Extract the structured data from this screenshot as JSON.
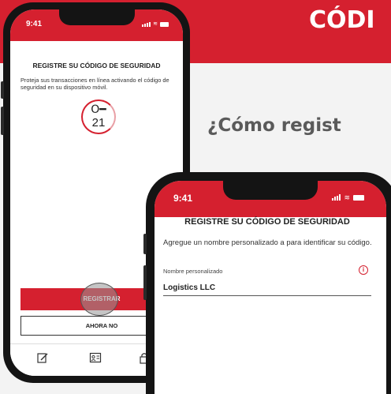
{
  "banner": {
    "title": "CÓDI",
    "color": "#d5202f"
  },
  "subtitle": "¿Cómo regist",
  "phone_back": {
    "status": {
      "time": "9:41"
    },
    "heading": "REGISTRE SU CÓDIGO DE SEGURIDAD",
    "description": "Proteja sus transacciones en línea activando el código de seguridad en su dispositivo móvil.",
    "key_icon": "key-icon",
    "key_number": "21",
    "register_button": "REGISTRAR",
    "later_button": "AHORA NO",
    "tabbar": [
      "edit-icon",
      "id-card-icon",
      "lock-icon"
    ]
  },
  "phone_front": {
    "status": {
      "time": "9:41"
    },
    "heading": "REGISTRE SU CÓDIGO DE SEGURIDAD",
    "description": "Agregue un nombre personalizado a para identificar su código.",
    "field": {
      "label": "Nombre personalizado",
      "value": "Logistics LLC",
      "info_icon": "info-icon"
    }
  }
}
